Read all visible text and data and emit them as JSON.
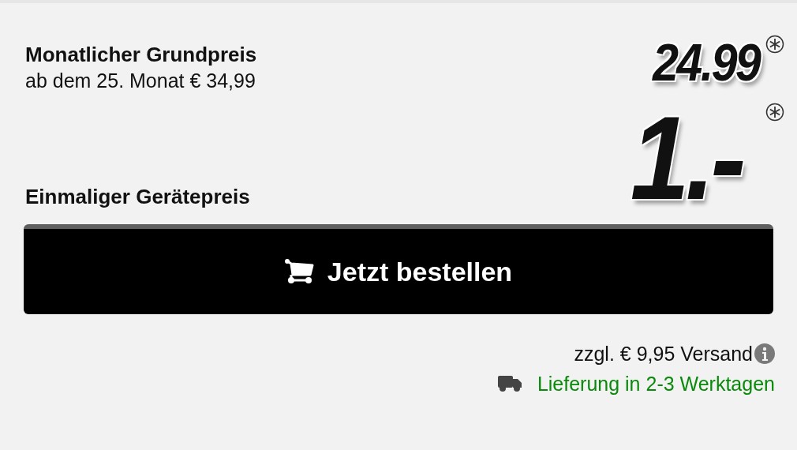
{
  "monthly": {
    "label": "Monatlicher Grundpreis",
    "note": "ab dem 25. Monat € 34,99",
    "price": "24.99"
  },
  "device": {
    "label": "Einmaliger Gerätepreis",
    "price": "1.-"
  },
  "order_button": {
    "label": "Jetzt bestellen"
  },
  "shipping": {
    "cost": "zzgl. € 9,95 Versand",
    "delivery": "Lieferung in 2-3 Werktagen"
  }
}
